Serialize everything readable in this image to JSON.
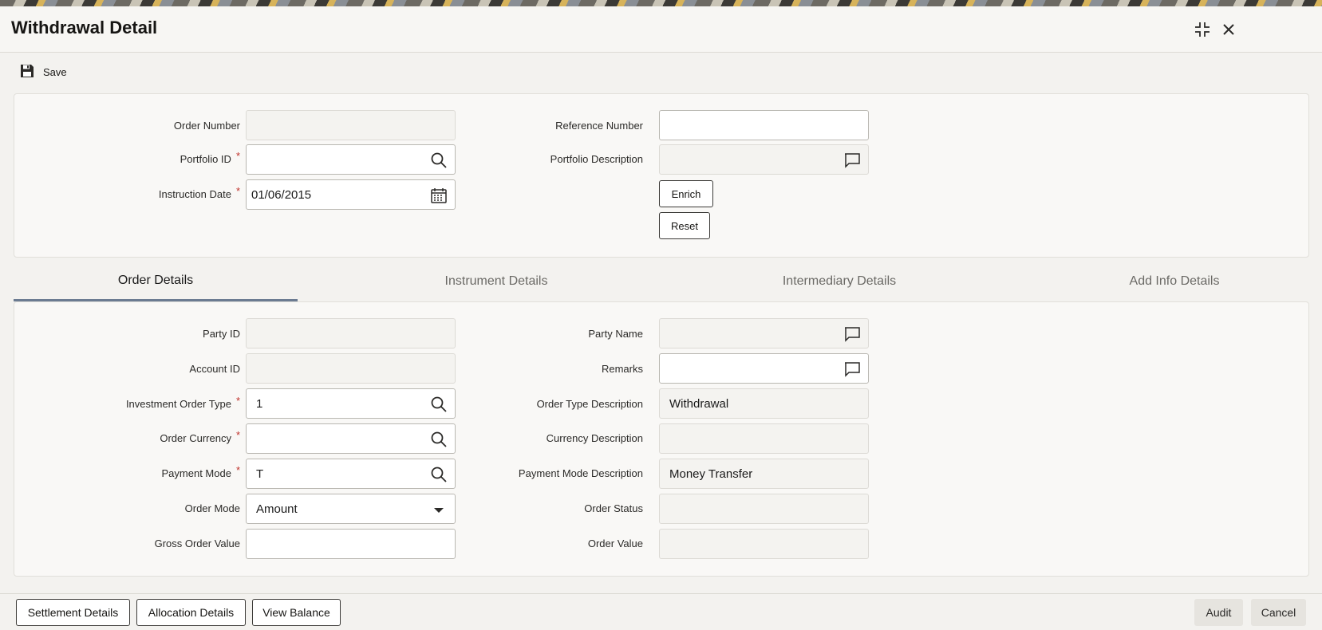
{
  "window": {
    "title": "Withdrawal Detail"
  },
  "toolbar": {
    "save_label": "Save"
  },
  "header_form": {
    "order_number": {
      "label": "Order Number",
      "value": ""
    },
    "portfolio_id": {
      "label": "Portfolio ID",
      "required_mark": "*",
      "value": ""
    },
    "instruction_date": {
      "label": "Instruction Date",
      "required_mark": "*",
      "value": "01/06/2015"
    },
    "reference_number": {
      "label": "Reference Number",
      "value": ""
    },
    "portfolio_description": {
      "label": "Portfolio Description",
      "value": ""
    },
    "enrich_label": "Enrich",
    "reset_label": "Reset"
  },
  "tabs": [
    {
      "label": "Order Details",
      "active": true
    },
    {
      "label": "Instrument Details",
      "active": false
    },
    {
      "label": "Intermediary Details",
      "active": false
    },
    {
      "label": "Add Info Details",
      "active": false
    }
  ],
  "order_details": {
    "party_id": {
      "label": "Party ID",
      "value": ""
    },
    "account_id": {
      "label": "Account ID",
      "value": ""
    },
    "investment_order_type": {
      "label": "Investment Order Type",
      "required_mark": "*",
      "value": "1"
    },
    "order_currency": {
      "label": "Order Currency",
      "required_mark": "*",
      "value": ""
    },
    "payment_mode": {
      "label": "Payment Mode",
      "required_mark": "*",
      "value": "T"
    },
    "order_mode": {
      "label": "Order Mode",
      "value": "Amount"
    },
    "gross_order_value": {
      "label": "Gross Order Value",
      "value": ""
    },
    "party_name": {
      "label": "Party Name",
      "value": ""
    },
    "remarks": {
      "label": "Remarks",
      "value": ""
    },
    "order_type_description": {
      "label": "Order Type Description",
      "value": "Withdrawal"
    },
    "currency_description": {
      "label": "Currency Description",
      "value": ""
    },
    "payment_mode_description": {
      "label": "Payment Mode Description",
      "value": "Money Transfer"
    },
    "order_status": {
      "label": "Order Status",
      "value": ""
    },
    "order_value": {
      "label": "Order Value",
      "value": ""
    }
  },
  "footer": {
    "settlement_details_label": "Settlement Details",
    "allocation_details_label": "Allocation Details",
    "view_balance_label": "View Balance",
    "audit_label": "Audit",
    "cancel_label": "Cancel"
  },
  "icons": {
    "save": "floppy-disk-icon",
    "maximize": "maximize-icon",
    "close": "close-icon",
    "search": "search-icon",
    "calendar": "calendar-icon",
    "comment": "comment-icon",
    "dropdown": "caret-down-icon"
  },
  "colors": {
    "required": "#c0322b",
    "tab_active_underline": "#6b7b91",
    "panel_bg": "#f9f8f6"
  }
}
